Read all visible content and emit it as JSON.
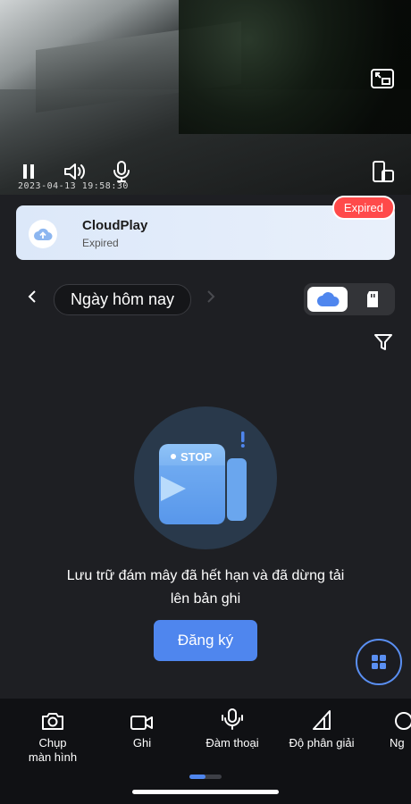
{
  "video": {
    "timestamp": "2023-04-13 19:58:30",
    "icons": [
      "pause-icon",
      "volume-icon",
      "microphone-icon",
      "picture-in-picture-icon",
      "device-rotate-icon"
    ]
  },
  "cloud_card": {
    "title": "CloudPlay",
    "status": "Expired",
    "badge": "Expired",
    "icon": "cloud-upload-icon",
    "badge_color": "#ff4a4a"
  },
  "date_nav": {
    "label": "Ngày hôm nay",
    "prev_icon": "chevron-left-icon",
    "next_icon": "chevron-right-icon"
  },
  "storage_toggle": {
    "options": [
      "cloud",
      "sd-card"
    ],
    "selected": "cloud"
  },
  "empty_state": {
    "illustration_text": "STOP",
    "message_line1": "Lưu trữ đám mây đã hết hạn và đã dừng tải",
    "message_line2": "lên bản ghi",
    "button_label": "Đăng ký"
  },
  "bottom_tabs": [
    {
      "label": "Chụp",
      "label2": "màn hình",
      "icon": "camera-icon"
    },
    {
      "label": "Ghi",
      "icon": "video-record-icon"
    },
    {
      "label": "Đàm thoại",
      "icon": "microphone-icon"
    },
    {
      "label": "Độ phân giải",
      "icon": "resolution-icon"
    },
    {
      "label": "Ng",
      "icon": "night-mode-icon"
    }
  ],
  "colors": {
    "accent": "#4f86ee",
    "background": "#1e1f23"
  }
}
